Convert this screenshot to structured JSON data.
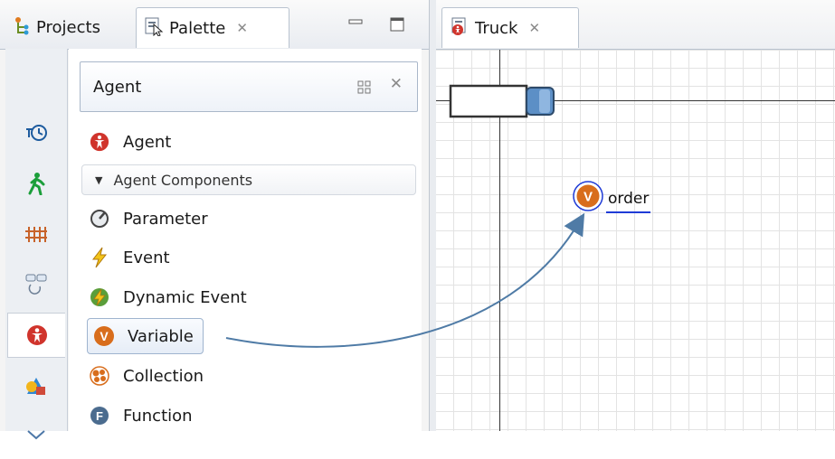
{
  "left_view": {
    "tabs": [
      {
        "label": "Projects",
        "icon": "projects-icon"
      },
      {
        "label": "Palette",
        "icon": "palette-icon"
      }
    ]
  },
  "palette": {
    "header": "Agent",
    "items_top": [
      {
        "label": "Agent",
        "icon": "agent-icon"
      }
    ],
    "section": "Agent Components",
    "items": [
      {
        "label": "Parameter",
        "icon": "parameter-icon"
      },
      {
        "label": "Event",
        "icon": "event-icon"
      },
      {
        "label": "Dynamic Event",
        "icon": "dynamic-event-icon"
      },
      {
        "label": "Variable",
        "icon": "variable-icon"
      },
      {
        "label": "Collection",
        "icon": "collection-icon"
      },
      {
        "label": "Function",
        "icon": "function-icon"
      }
    ],
    "highlighted_item": "Variable"
  },
  "toolbar": {
    "categories": [
      "process-modeling-icon",
      "pedestrian-icon",
      "rail-icon",
      "statechart-icon",
      "agent-icon",
      "presentation-icon",
      "more-icon"
    ],
    "selected": "agent-icon"
  },
  "editor": {
    "tab_label": "Truck",
    "variable_name": "order",
    "variable_badge": "V"
  },
  "colors": {
    "variable_orange": "#d86d1c",
    "selection_blue": "#1f3bd6",
    "agent_red": "#d0342c",
    "arrow": "#4f7ba6"
  }
}
